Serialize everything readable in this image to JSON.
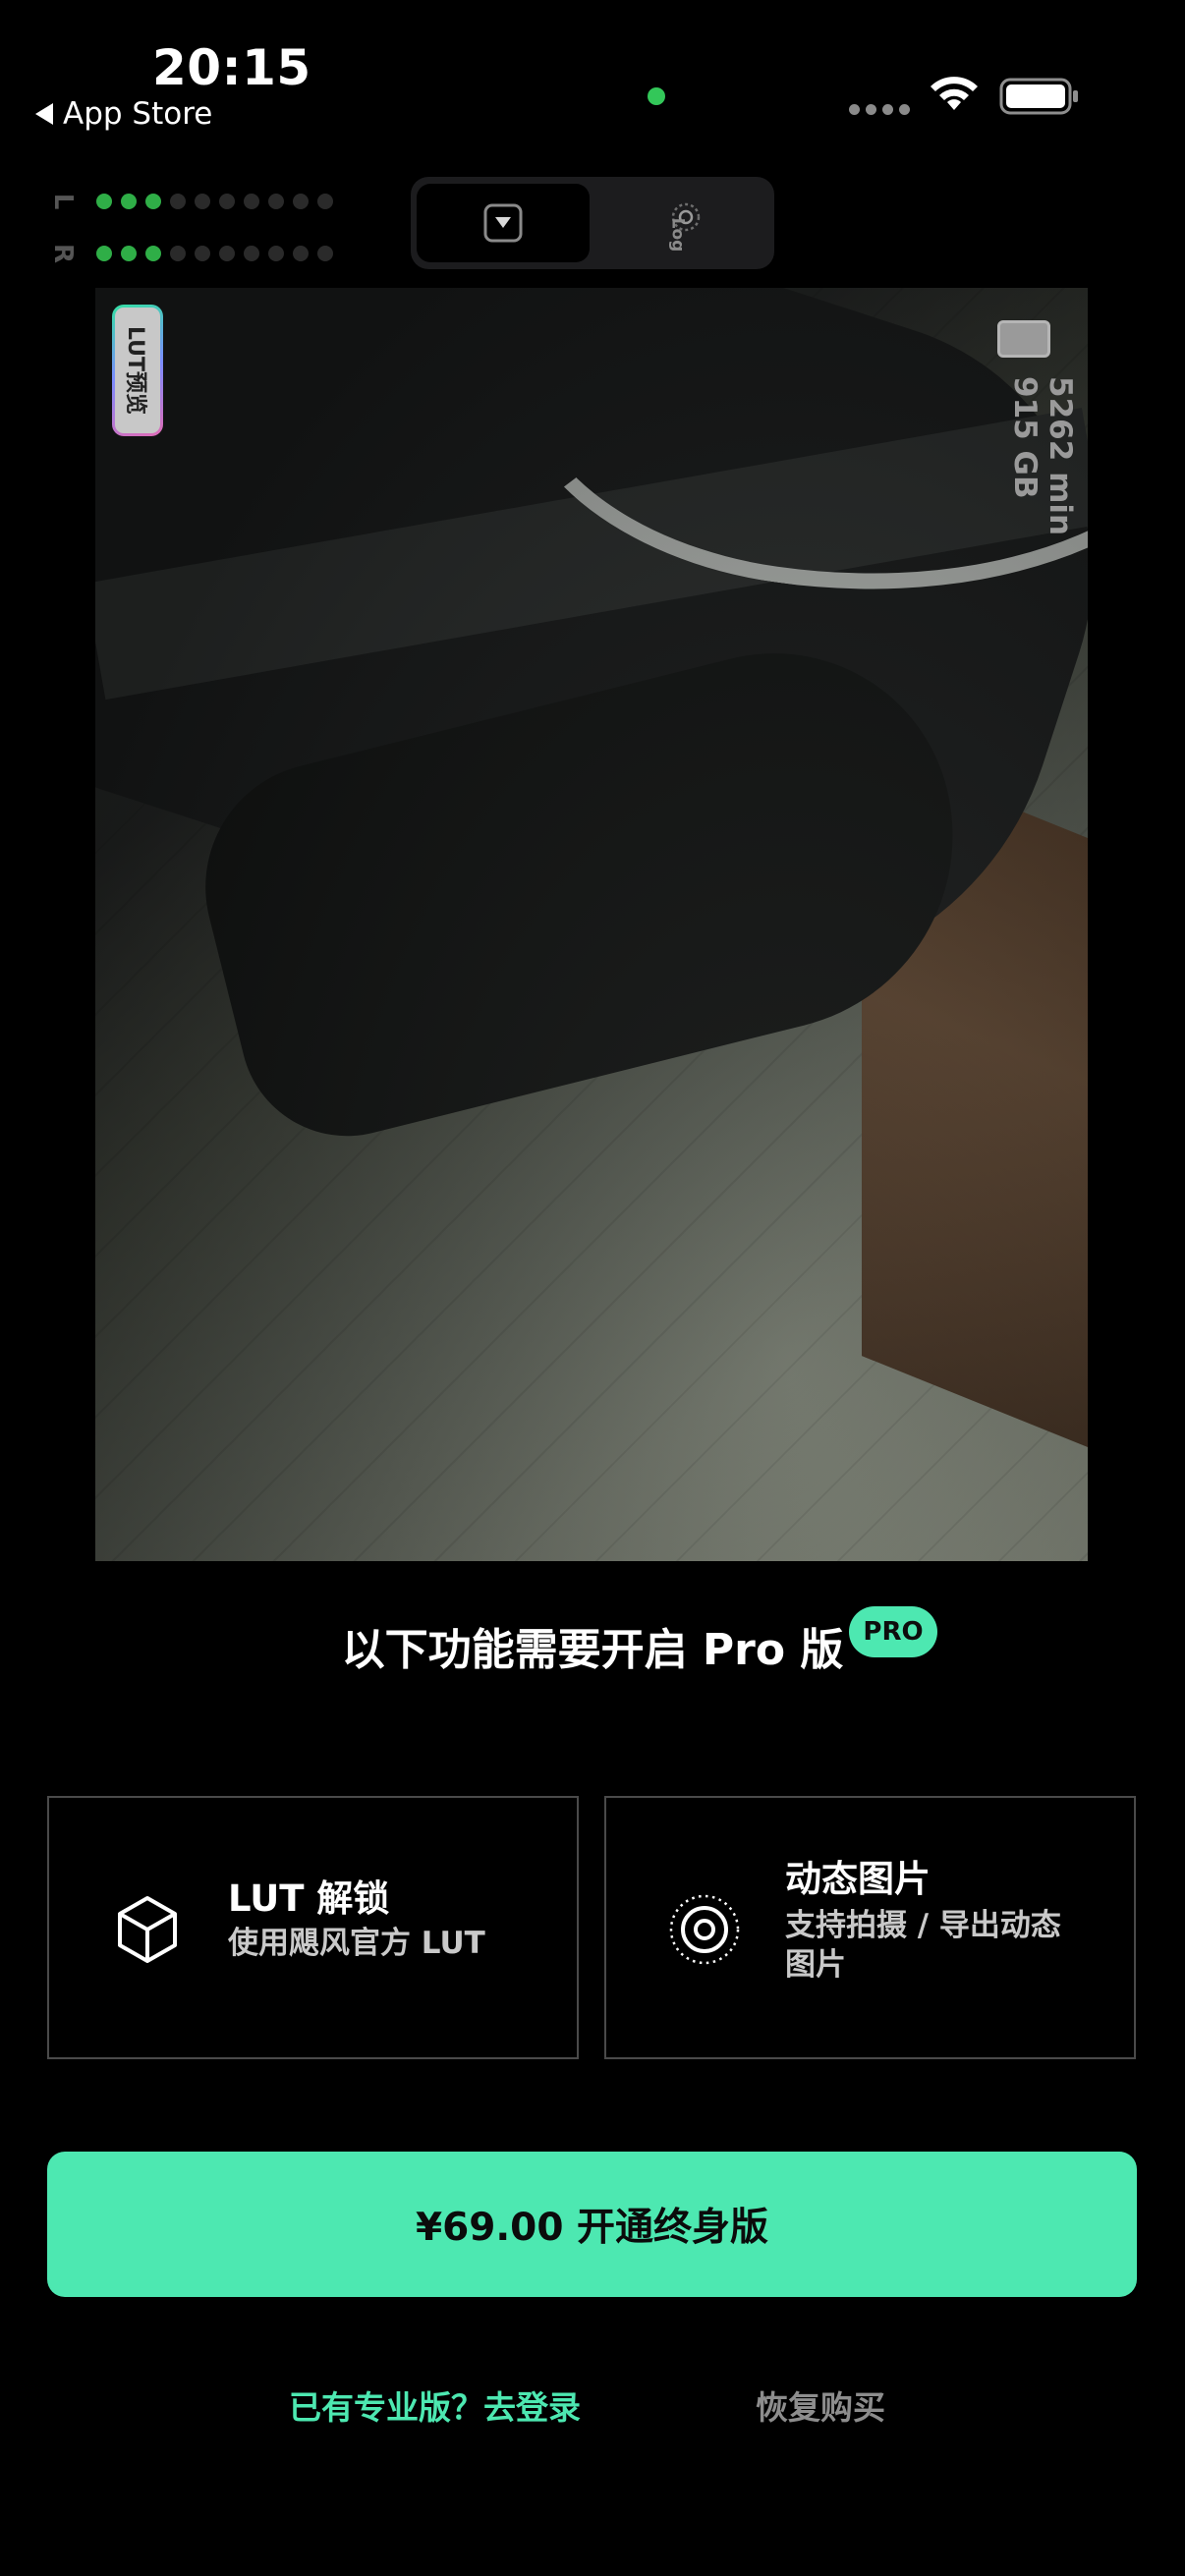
{
  "status_bar": {
    "time": "20:15",
    "back_label": "App Store"
  },
  "audio_meter": {
    "left_label": "L",
    "right_label": "R",
    "left_level": 3,
    "right_level": 3,
    "segments": 10,
    "active_color": "#2fae47"
  },
  "mode_switch": {
    "log_label": "Log",
    "active": "filter"
  },
  "preview": {
    "lut_badge": "LUT预览",
    "remaining_time": "5262 min",
    "free_space": "915 GB"
  },
  "pro": {
    "title": "以下功能需要开启 Pro 版",
    "badge": "PRO",
    "accent_color": "#4de8b1"
  },
  "features": [
    {
      "icon": "cube-icon",
      "title": "LUT 解锁",
      "desc": "使用飓风官方 LUT"
    },
    {
      "icon": "live-photo-icon",
      "title": "动态图片",
      "desc": "支持拍摄 / 导出动态图片"
    }
  ],
  "purchase": {
    "button_label": "¥69.00 开通终身版"
  },
  "links": {
    "login": "已有专业版？去登录",
    "restore": "恢复购买"
  }
}
